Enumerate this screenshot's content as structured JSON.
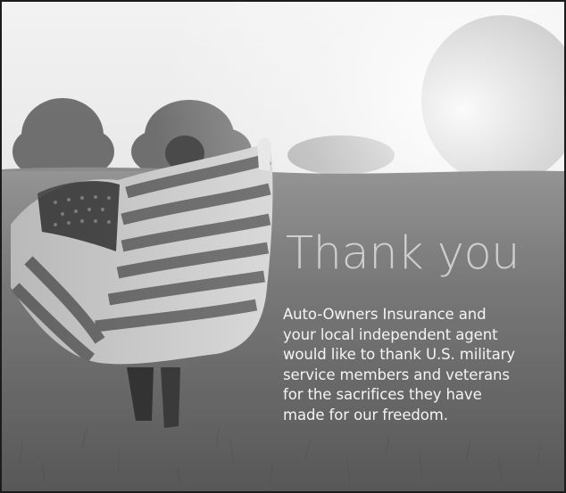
{
  "headline": "Thank you",
  "message_lines": [
    "Auto-Owners Insurance and",
    "your local independent agent",
    "would like to thank U.S. military",
    "service members and veterans",
    "for the sacrifices they have",
    "made for our freedom."
  ],
  "background_photo": {
    "icon": "child-running-with-american-flag-photo",
    "tone": "grayscale"
  }
}
